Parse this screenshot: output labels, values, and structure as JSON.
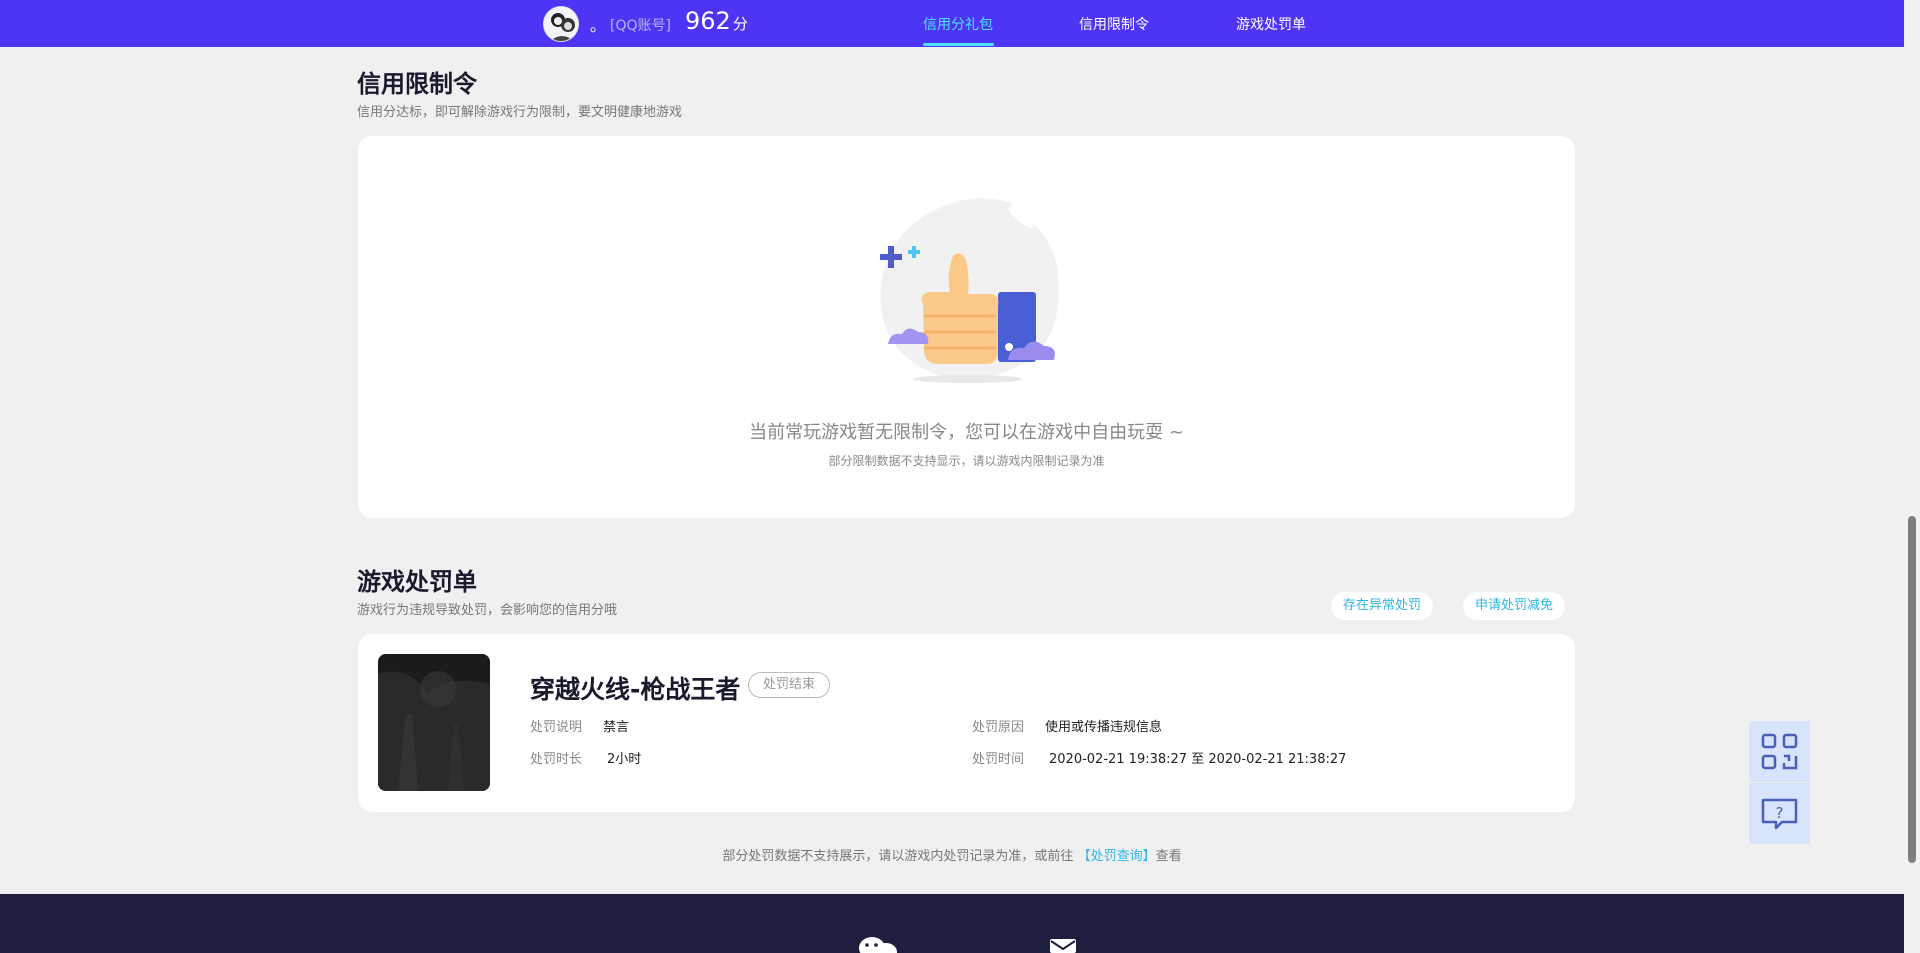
{
  "header": {
    "nickname": "。",
    "account_type": "[QQ账号]",
    "score": "962",
    "score_unit": "分",
    "nav": [
      {
        "label": "信用分礼包"
      },
      {
        "label": "信用限制令"
      },
      {
        "label": "游戏处罚单"
      }
    ]
  },
  "restrictions": {
    "title": "信用限制令",
    "subtitle": "信用分达标，即可解除游戏行为限制，要文明健康地游戏",
    "empty_message": "当前常玩游戏暂无限制令，您可以在游戏中自由玩耍 ~",
    "empty_note": "部分限制数据不支持显示，请以游戏内限制记录为准"
  },
  "penalties": {
    "title": "游戏处罚单",
    "subtitle": "游戏行为违规导致处罚，会影响您的信用分哦",
    "btn_abnormal": "存在异常处罚",
    "btn_appeal": "申请处罚减免",
    "item": {
      "game": "穿越火线-枪战王者",
      "status": "处罚结束",
      "desc_label": "处罚说明",
      "desc_value": "禁言",
      "duration_label": "处罚时长",
      "duration_value": "2小时",
      "reason_label": "处罚原因",
      "reason_value": "使用或传播违规信息",
      "time_label": "处罚时间",
      "time_value": "2020-02-21 19:38:27 至 2020-02-21 21:38:27"
    },
    "footer_prefix": "部分处罚数据不支持展示，请以游戏内处罚记录为准，或前往",
    "footer_link": "【处罚查询】",
    "footer_suffix": "查看"
  },
  "colors": {
    "header_bg": "#4c35f5",
    "accent": "#4ee3ff",
    "link": "#2fb6e8",
    "footer_bg": "#1e1f3f"
  },
  "icons": [
    "qr-code-icon",
    "help-chat-icon",
    "wechat-icon",
    "mail-icon",
    "thumbs-up-illustration"
  ]
}
